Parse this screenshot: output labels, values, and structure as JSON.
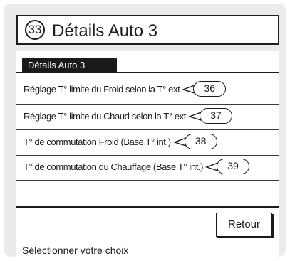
{
  "header": {
    "screen_number": "33",
    "title": "Détails Auto 3"
  },
  "section": {
    "label": "Détails Auto 3"
  },
  "menu": {
    "items": [
      {
        "label": "Réglage T° limite du Froid selon la T° ext",
        "ref": "36"
      },
      {
        "label": "Réglage T° limite du Chaud selon la T° ext",
        "ref": "37"
      },
      {
        "label": "T° de commutation Froid (Base T° int.)",
        "ref": "38"
      },
      {
        "label": "T° de commutation du Chauffage (Base T° int.)",
        "ref": "39"
      }
    ]
  },
  "buttons": {
    "back_label": "Retour"
  },
  "status": {
    "text": "Sélectionner votre choix"
  }
}
